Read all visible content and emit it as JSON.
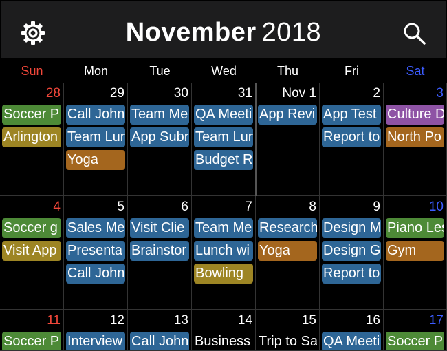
{
  "header": {
    "month": "November",
    "year": "2018",
    "gear_icon": "gear-icon",
    "search_icon": "search-icon"
  },
  "weekdays": [
    "Sun",
    "Mon",
    "Tue",
    "Wed",
    "Thu",
    "Fri",
    "Sat"
  ],
  "colors": {
    "green": "#4d8a37",
    "olive": "#9d8524",
    "orange": "#a4661e",
    "blue": "#2e6696",
    "purple": "#8e53a5",
    "sunday": "#f2473a",
    "saturday": "#3c5cff"
  },
  "weeks": [
    {
      "days": [
        {
          "num": "28",
          "events": [
            {
              "title": "Soccer P",
              "color": "green"
            },
            {
              "title": "Arlington",
              "color": "olive"
            }
          ]
        },
        {
          "num": "29",
          "events": [
            {
              "title": "Call John",
              "color": "blue"
            },
            {
              "title": "Team Lun",
              "color": "blue"
            },
            {
              "title": "Yoga",
              "color": "orange"
            }
          ]
        },
        {
          "num": "30",
          "events": [
            {
              "title": "Team Me",
              "color": "blue"
            },
            {
              "title": "App Subr",
              "color": "blue"
            }
          ]
        },
        {
          "num": "31",
          "events": [
            {
              "title": "QA Meeti",
              "color": "blue"
            },
            {
              "title": "Team Lun",
              "color": "blue"
            },
            {
              "title": "Budget R",
              "color": "blue"
            }
          ]
        },
        {
          "num": "Nov 1",
          "events": [
            {
              "title": "App Revi",
              "color": "blue"
            }
          ]
        },
        {
          "num": "2",
          "events": [
            {
              "title": "App Test",
              "color": "blue"
            },
            {
              "title": "Report to",
              "color": "blue"
            }
          ]
        },
        {
          "num": "3",
          "events": [
            {
              "title": "Culture D",
              "color": "purple"
            },
            {
              "title": "North Po",
              "color": "orange"
            }
          ]
        }
      ]
    },
    {
      "days": [
        {
          "num": "4",
          "events": [
            {
              "title": "Soccer g",
              "color": "green"
            },
            {
              "title": "Visit App",
              "color": "olive"
            }
          ]
        },
        {
          "num": "5",
          "events": [
            {
              "title": "Sales Me",
              "color": "blue"
            },
            {
              "title": "Presenta",
              "color": "blue"
            },
            {
              "title": "Call John",
              "color": "blue"
            }
          ]
        },
        {
          "num": "6",
          "events": [
            {
              "title": "Visit Clie",
              "color": "blue"
            },
            {
              "title": "Brainstor",
              "color": "blue"
            }
          ]
        },
        {
          "num": "7",
          "events": [
            {
              "title": "Team Me",
              "color": "blue"
            },
            {
              "title": "Lunch wi",
              "color": "blue"
            },
            {
              "title": "Bowling",
              "color": "olive"
            }
          ]
        },
        {
          "num": "8",
          "events": [
            {
              "title": "Research",
              "color": "blue"
            },
            {
              "title": "Yoga",
              "color": "orange"
            }
          ]
        },
        {
          "num": "9",
          "events": [
            {
              "title": "Design M",
              "color": "blue"
            },
            {
              "title": "Design G",
              "color": "blue"
            },
            {
              "title": "Report to",
              "color": "blue"
            }
          ]
        },
        {
          "num": "10",
          "events": [
            {
              "title": "Piano Les",
              "color": "green"
            },
            {
              "title": "Gym",
              "color": "orange"
            }
          ]
        }
      ]
    },
    {
      "days": [
        {
          "num": "11",
          "events": [
            {
              "title": "Soccer P",
              "color": "green"
            }
          ]
        },
        {
          "num": "12",
          "events": [
            {
              "title": "Interview",
              "color": "blue"
            }
          ]
        },
        {
          "num": "13",
          "events": [
            {
              "title": "Call John",
              "color": "blue"
            }
          ]
        },
        {
          "num": "14",
          "events": [
            {
              "title": "Business",
              "color": "plain"
            }
          ]
        },
        {
          "num": "15",
          "events": [
            {
              "title": "Trip to Sa",
              "color": "plain"
            }
          ]
        },
        {
          "num": "16",
          "events": [
            {
              "title": "QA Meeti",
              "color": "blue"
            }
          ]
        },
        {
          "num": "17",
          "events": [
            {
              "title": "Soccer P",
              "color": "green"
            }
          ]
        }
      ]
    }
  ]
}
